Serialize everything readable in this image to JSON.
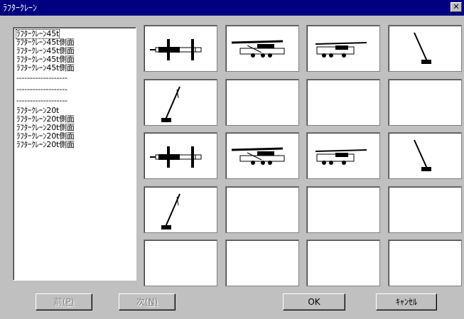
{
  "window": {
    "title": "ﾗﾌﾀｰｸﾚｰﾝ",
    "close_glyph": "✕"
  },
  "list": {
    "items": [
      {
        "label": "ﾗﾌﾀｰｸﾚｰﾝ45t",
        "focused": true
      },
      {
        "label": "ﾗﾌﾀｰｸﾚｰﾝ45t側面"
      },
      {
        "label": "ﾗﾌﾀｰｸﾚｰﾝ45t側面"
      },
      {
        "label": "ﾗﾌﾀｰｸﾚｰﾝ45t側面"
      },
      {
        "label": "ﾗﾌﾀｰｸﾚｰﾝ45t側面"
      },
      {
        "label": "-------------------"
      },
      {
        "label": "-------------------"
      },
      {
        "label": "-------------------"
      },
      {
        "label": "ﾗﾌﾀｰｸﾚｰﾝ20t"
      },
      {
        "label": "ﾗﾌﾀｰｸﾚｰﾝ20t側面"
      },
      {
        "label": "ﾗﾌﾀｰｸﾚｰﾝ20t側面"
      },
      {
        "label": "ﾗﾌﾀｰｸﾚｰﾝ20t側面"
      },
      {
        "label": "ﾗﾌﾀｰｸﾚｰﾝ20t側面"
      }
    ]
  },
  "grid": {
    "cells": [
      {
        "symbol": "crane-45t-top-view-icon"
      },
      {
        "symbol": "crane-45t-side-view-icon"
      },
      {
        "symbol": "crane-45t-side-view-short-icon"
      },
      {
        "symbol": "crane-45t-boom-raised-icon"
      },
      {
        "symbol": "crane-45t-boom-angled-icon"
      },
      {
        "symbol": "empty"
      },
      {
        "symbol": "empty"
      },
      {
        "symbol": "empty"
      },
      {
        "symbol": "crane-20t-top-view-icon"
      },
      {
        "symbol": "crane-20t-side-view-icon"
      },
      {
        "symbol": "crane-20t-side-view-short-icon"
      },
      {
        "symbol": "crane-20t-boom-raised-icon"
      },
      {
        "symbol": "crane-20t-boom-angled-icon"
      },
      {
        "symbol": "empty"
      },
      {
        "symbol": "empty"
      },
      {
        "symbol": "empty"
      },
      {
        "symbol": "empty"
      },
      {
        "symbol": "empty"
      },
      {
        "symbol": "empty"
      },
      {
        "symbol": "empty"
      }
    ]
  },
  "buttons": {
    "prev": {
      "label": "前",
      "accel": "(P)",
      "enabled": false
    },
    "next": {
      "label": "次",
      "accel": "(N)",
      "enabled": false
    },
    "ok": {
      "label": "OK"
    },
    "cancel": {
      "label": "ｷｬﾝｾﾙ"
    }
  }
}
